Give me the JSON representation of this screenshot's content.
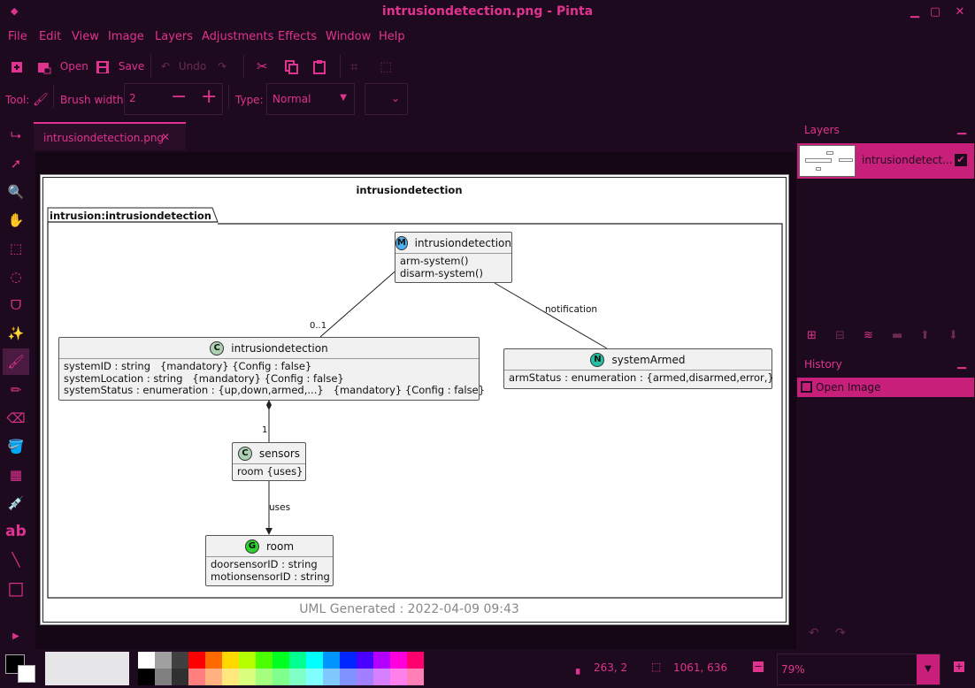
{
  "window": {
    "title": "intrusiondetection.png - Pinta"
  },
  "menu": [
    "File",
    "Edit",
    "View",
    "Image",
    "Layers",
    "Adjustments",
    "Effects",
    "Window",
    "Help"
  ],
  "toolbar": {
    "open": "Open",
    "save": "Save",
    "undo": "Undo"
  },
  "options": {
    "tool_label": "Tool:",
    "brush_width_label": "Brush width:",
    "brush_width_value": "2",
    "type_label": "Type:",
    "type_value": "Normal"
  },
  "tab": {
    "name": "intrusiondetection.png"
  },
  "diagram": {
    "title": "intrusiondetection",
    "package": "intrusion:intrusiondetection",
    "module": {
      "name": "intrusiondetection",
      "stereo": "M",
      "ops": [
        "arm-system()",
        "disarm-system()"
      ]
    },
    "main_class": {
      "name": "intrusiondetection",
      "stereo": "C",
      "attrs": [
        "systemID : string   {mandatory} {Config : false}",
        "systemLocation : string   {mandatory} {Config : false}",
        "systemStatus : enumeration : {up,down,armed,...}   {mandatory} {Config : false}"
      ]
    },
    "notification": {
      "name": "systemArmed",
      "stereo": "N",
      "attrs": [
        "armStatus : enumeration : {armed,disarmed,error,}"
      ]
    },
    "sensors": {
      "name": "sensors",
      "stereo": "C",
      "attrs": [
        "room {uses}"
      ]
    },
    "room": {
      "name": "room",
      "stereo": "G",
      "attrs": [
        "doorsensorID : string",
        "motionsensorID : string"
      ]
    },
    "labels": {
      "mult_01": "0..1",
      "notification": "notification",
      "mult_1": "1",
      "uses": "uses"
    },
    "footer": "UML Generated : 2022-04-09 09:43"
  },
  "layers": {
    "title": "Layers",
    "items": [
      {
        "name": "intrusiondetect..."
      }
    ]
  },
  "history": {
    "title": "History",
    "items": [
      {
        "name": "Open Image"
      }
    ]
  },
  "status": {
    "cursor": "263, 2",
    "selection": "1061, 636",
    "zoom": "79%"
  },
  "palette": {
    "top": [
      "#ffffff",
      "#a0a0a0",
      "#404040",
      "#ff0000",
      "#ff6a00",
      "#ffd800",
      "#b6ff00",
      "#4cff00",
      "#00ff21",
      "#00ff90",
      "#00ffff",
      "#0094ff",
      "#0026ff",
      "#4800ff",
      "#b200ff",
      "#ff00dc",
      "#ff006e"
    ],
    "bottom": [
      "#000000",
      "#808080",
      "#303030",
      "#ff7f7f",
      "#ffb27f",
      "#ffe97f",
      "#daff7f",
      "#a5ff7f",
      "#7fff8e",
      "#7fffc5",
      "#7fffff",
      "#7fc9ff",
      "#7f92ff",
      "#a17fff",
      "#d67fff",
      "#ff7fed",
      "#ff7fb6"
    ]
  }
}
